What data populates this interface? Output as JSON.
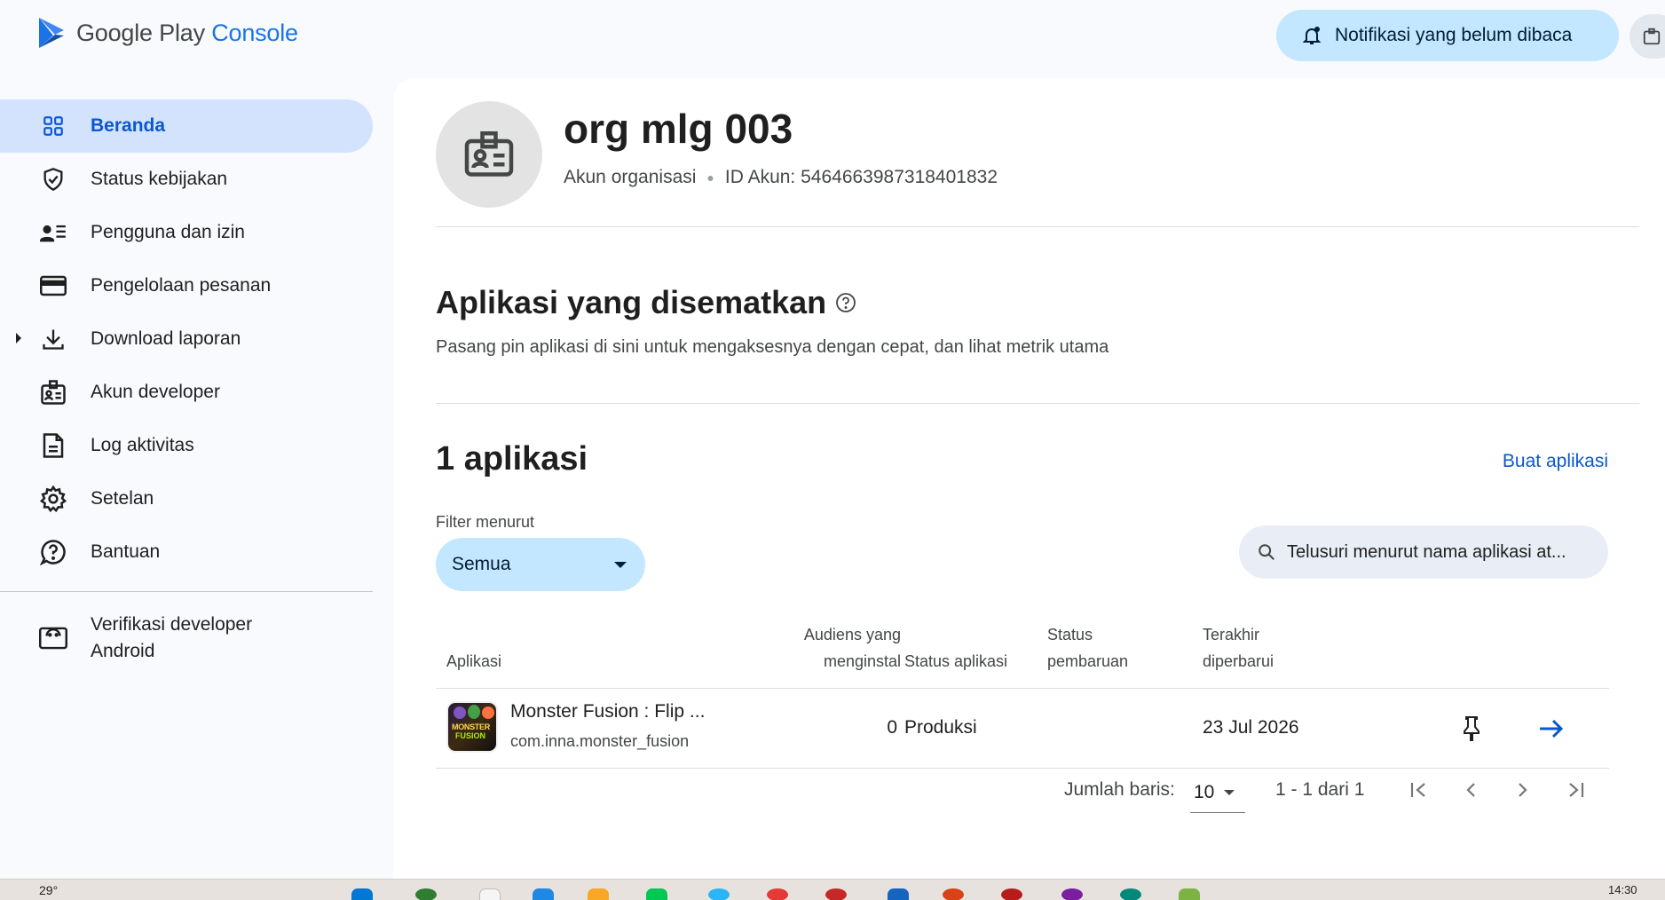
{
  "header": {
    "logo_google_play": "Google Play",
    "logo_console": "Console",
    "notification_button": "Notifikasi yang belum dibaca"
  },
  "sidebar": {
    "items": [
      {
        "label": "Beranda",
        "icon": "home-grid-icon",
        "active": true
      },
      {
        "label": "Status kebijakan",
        "icon": "shield-check-icon"
      },
      {
        "label": "Pengguna dan izin",
        "icon": "users-list-icon"
      },
      {
        "label": "Pengelolaan pesanan",
        "icon": "credit-card-icon"
      },
      {
        "label": "Download laporan",
        "icon": "download-icon",
        "expandable": true
      },
      {
        "label": "Akun developer",
        "icon": "badge-icon"
      },
      {
        "label": "Log aktivitas",
        "icon": "document-icon"
      },
      {
        "label": "Setelan",
        "icon": "gear-icon"
      },
      {
        "label": "Bantuan",
        "icon": "help-icon"
      }
    ],
    "bottom_item": {
      "line1": "Verifikasi developer",
      "line2": "Android",
      "icon": "android-verify-icon"
    }
  },
  "account": {
    "name": "org mlg 003",
    "type": "Akun organisasi",
    "account_id": "ID Akun: 5464663987318401832"
  },
  "pinned": {
    "title": "Aplikasi yang disematkan",
    "subtitle": "Pasang pin aplikasi di sini untuk mengaksesnya dengan cepat, dan lihat metrik utama"
  },
  "apps": {
    "count_title": "1 aplikasi",
    "create_link": "Buat aplikasi",
    "filter_label": "Filter menurut",
    "filter_value": "Semua",
    "search_placeholder": "Telusuri menurut nama aplikasi at...",
    "columns": {
      "app": "Aplikasi",
      "audience_1": "Audiens yang",
      "audience_2": "menginstal",
      "status": "Status aplikasi",
      "update_1": "Status",
      "update_2": "pembaruan",
      "last_1": "Terakhir",
      "last_2": "diperbarui"
    },
    "rows": [
      {
        "name": "Monster Fusion : Flip ...",
        "package": "com.inna.monster_fusion",
        "icon_text_1": "MONSTER",
        "icon_text_2": "FUSION",
        "installs": "0",
        "status": "Produksi",
        "update_status": "",
        "last_updated": "23 Jul 2026"
      }
    ],
    "pagination": {
      "rows_label": "Jumlah baris:",
      "rows_value": "10",
      "range": "1 - 1 dari 1"
    }
  },
  "taskbar": {
    "weather": "29°",
    "time": "14:30"
  },
  "colors": {
    "accent": "#0b57d0",
    "chip_bg": "#c2e7ff",
    "active_nav_bg": "#d3e3fd"
  }
}
